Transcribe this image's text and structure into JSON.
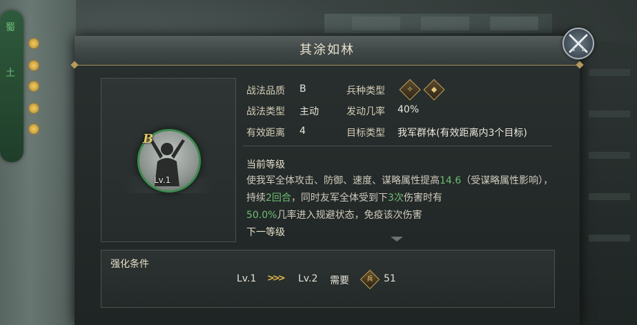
{
  "background": {
    "pillar_text": [
      "蜀",
      "土"
    ],
    "top_tabs": [
      "",
      "",
      ""
    ]
  },
  "panel": {
    "title": "其涂如林"
  },
  "tactic": {
    "quality_badge": "B",
    "level_badge": "Lv.1",
    "quality_label": "战法品质",
    "quality_value": "B",
    "troop_type_label": "兵种类型",
    "troop_icons": [
      "bow-icon",
      "shield-icon"
    ],
    "type_label": "战法类型",
    "type_value": "主动",
    "trigger_label": "发动几率",
    "trigger_value": "40%",
    "range_label": "有效距离",
    "range_value": "4",
    "target_label": "目标类型",
    "target_value": "我军群体(有效距离内3个目标)"
  },
  "current_level": {
    "title": "当前等级",
    "desc_1": "使我军全体攻击、防御、速度、谋略属性提高",
    "value_1": "14.6",
    "desc_2": "（受谋略属性影响），持续",
    "value_2": "2回合",
    "desc_3": "，同时友军全体受到下",
    "value_3": "3次",
    "desc_4": "伤害时有",
    "value_4": "50.0%",
    "desc_5": "几率进入规避状态，免疫该次伤害"
  },
  "next_level": {
    "title": "下一等级"
  },
  "enhance": {
    "title": "强化条件",
    "from_level": "Lv.1",
    "to_level": "Lv.2",
    "need_label": "需要",
    "token_glyph": "兵",
    "cost": "51"
  },
  "colors": {
    "accent_gold": "#c9a35a",
    "highlight_green": "#6fbf72",
    "frame_green": "#3f8a52"
  }
}
